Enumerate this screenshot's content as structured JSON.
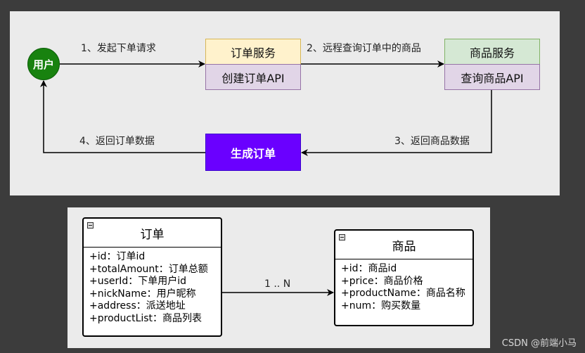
{
  "flow": {
    "user": "用户",
    "order_service": {
      "title": "订单服务",
      "api": "创建订单API"
    },
    "product_service": {
      "title": "商品服务",
      "api": "查询商品API"
    },
    "generate_order": "生成订单",
    "edges": {
      "step1": "1、发起下单请求",
      "step2": "2、远程查询订单中的商品",
      "step3": "3、返回商品数据",
      "step4": "4、返回订单数据"
    }
  },
  "uml": {
    "order": {
      "title": "订单",
      "fields": [
        "+id：订单id",
        "+totalAmount：订单总额",
        "+userId：下单用户id",
        "+nickName：用户昵称",
        "+address：派送地址",
        "+productList：商品列表"
      ]
    },
    "product": {
      "title": "商品",
      "fields": [
        "+id：商品id",
        "+price：商品价格",
        "+productName：商品名称",
        "+num：购买数量"
      ]
    },
    "multiplicity": "1 .. N"
  },
  "watermark": "CSDN @前端小马"
}
